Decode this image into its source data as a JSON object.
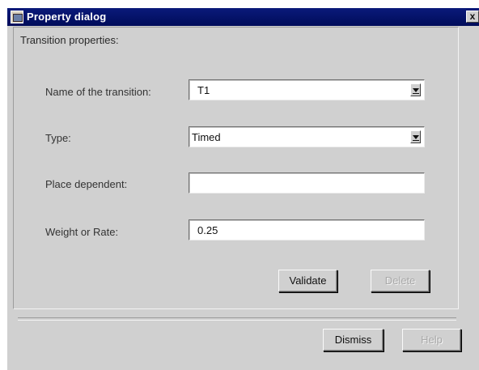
{
  "window": {
    "title": "Property dialog",
    "close_glyph": "x",
    "icon": "dialog-app-icon"
  },
  "group": {
    "title": "Transition properties:"
  },
  "fields": {
    "name": {
      "label": "Name of the transition:",
      "value": "T1",
      "control": "dropdown"
    },
    "type": {
      "label": "Type:",
      "value": "Timed",
      "control": "dropdown"
    },
    "place_dependent": {
      "label": "Place dependent:",
      "value": "",
      "control": "text"
    },
    "weight": {
      "label": "Weight or Rate:",
      "value": "0.25",
      "control": "text"
    }
  },
  "buttons": {
    "validate": "Validate",
    "delete": "Delete",
    "dismiss": "Dismiss",
    "help": "Help"
  },
  "colors": {
    "titlebar": "#0a1a7a",
    "dialog_bg": "#d0d0d0",
    "disabled_text": "#a8a8a8"
  }
}
